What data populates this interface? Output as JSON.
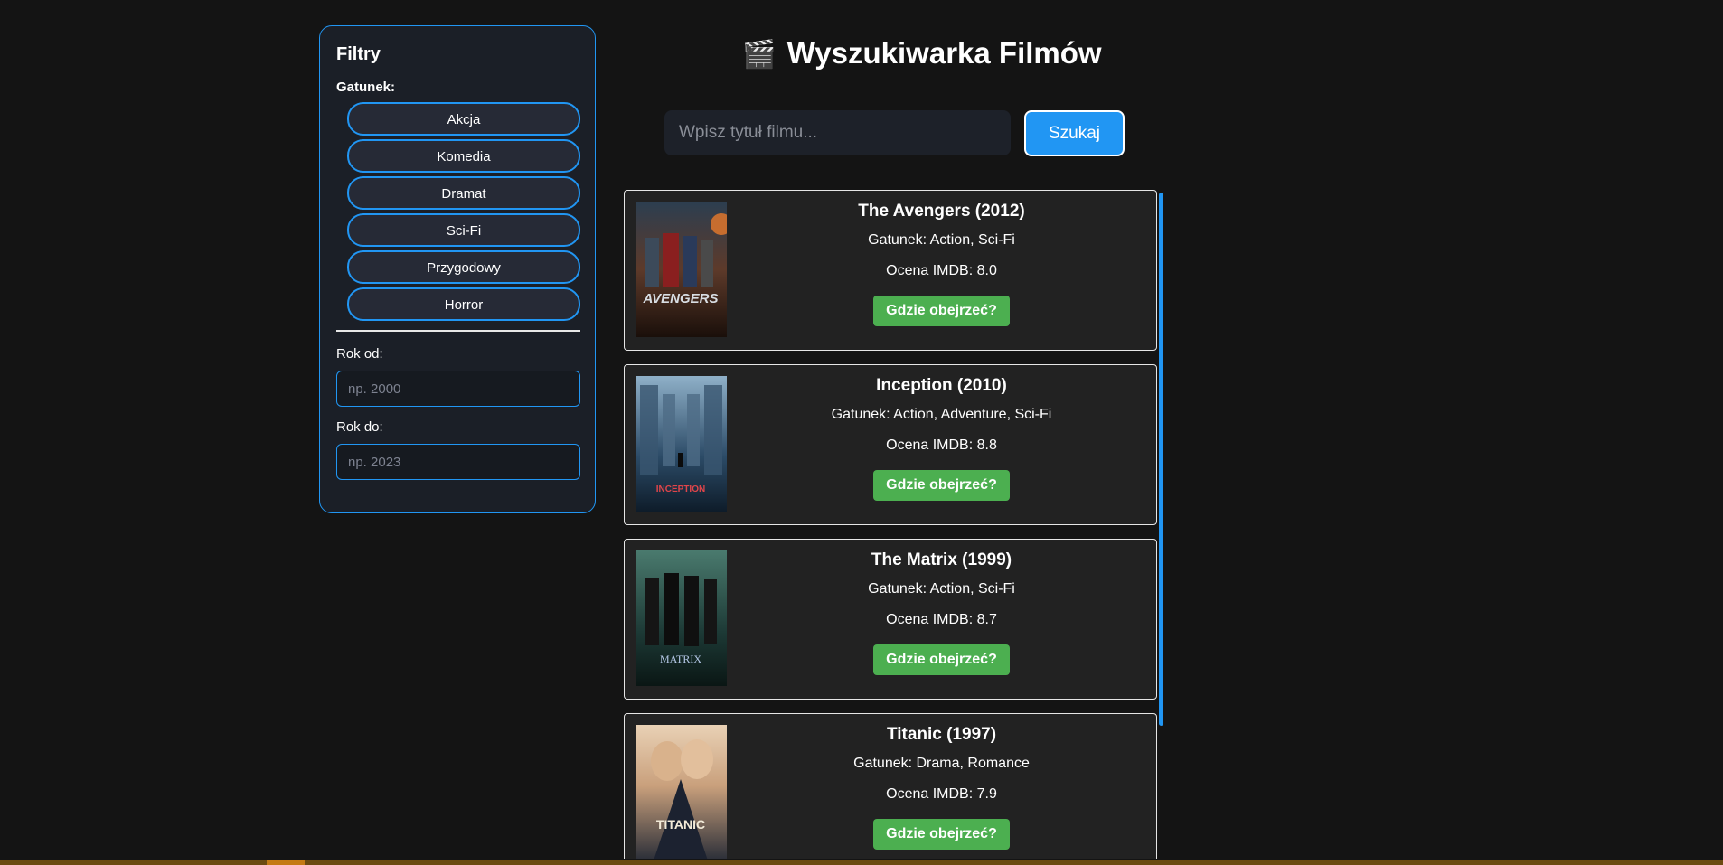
{
  "sidebar": {
    "title": "Filtry",
    "genre_label": "Gatunek:",
    "genres": [
      "Akcja",
      "Komedia",
      "Dramat",
      "Sci-Fi",
      "Przygodowy",
      "Horror"
    ],
    "year_from_label": "Rok od:",
    "year_from_placeholder": "np. 2000",
    "year_to_label": "Rok do:",
    "year_to_placeholder": "np. 2023"
  },
  "header": {
    "icon": "clapperboard-icon",
    "icon_glyph": "🎬",
    "title": "Wyszukiwarka Filmów"
  },
  "search": {
    "placeholder": "Wpisz tytuł filmu...",
    "button_label": "Szukaj"
  },
  "movies": [
    {
      "title": "The Avengers (2012)",
      "genre": "Gatunek: Action, Sci-Fi",
      "rating": "Ocena IMDB: 8.0",
      "button": "Gdzie obejrzeć?",
      "poster_text": "AVENGERS"
    },
    {
      "title": "Inception (2010)",
      "genre": "Gatunek: Action, Adventure, Sci-Fi",
      "rating": "Ocena IMDB: 8.8",
      "button": "Gdzie obejrzeć?",
      "poster_text": "INCEPTION"
    },
    {
      "title": "The Matrix (1999)",
      "genre": "Gatunek: Action, Sci-Fi",
      "rating": "Ocena IMDB: 8.7",
      "button": "Gdzie obejrzeć?",
      "poster_text": "MATRIX"
    },
    {
      "title": "Titanic (1997)",
      "genre": "Gatunek: Drama, Romance",
      "rating": "Ocena IMDB: 7.9",
      "button": "Gdzie obejrzeć?",
      "poster_text": "TITANIC"
    }
  ],
  "colors": {
    "accent": "#2196f3",
    "action_button": "#4caf50",
    "background": "#141414",
    "card": "#222222"
  }
}
